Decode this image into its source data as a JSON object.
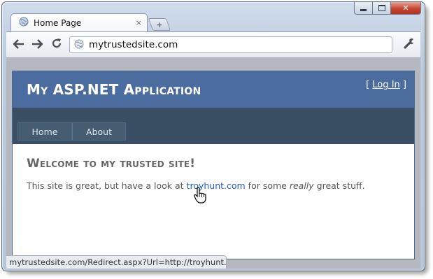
{
  "browser": {
    "tab": {
      "title": "Home Page",
      "close_glyph": "×"
    },
    "new_tab_glyph": "+",
    "omnibox": {
      "url": "mytrustedsite.com"
    },
    "status_bar": {
      "text": "mytrustedsite.com/Redirect.aspx?Url=http://troyhunt.com"
    },
    "icons": {
      "back": "back-arrow-icon",
      "forward": "forward-arrow-icon",
      "reload": "reload-icon",
      "menu": "wrench-icon",
      "favicon": "globe-icon",
      "cursor": "hand-pointer-icon"
    }
  },
  "site": {
    "header": {
      "title": "My ASP.NET Application",
      "login_prefix": "[ ",
      "login_label": "Log In",
      "login_suffix": " ]"
    },
    "menu": {
      "items": [
        {
          "label": "Home"
        },
        {
          "label": "About"
        }
      ]
    },
    "main": {
      "heading": "Welcome to my trusted site!",
      "intro_before": "This site is great, but have a look at ",
      "intro_link": "troyhunt.com",
      "intro_middle": " for some ",
      "intro_emphasis": "really",
      "intro_after": " great stuff."
    }
  },
  "colors": {
    "header_bg": "#4b6c9e",
    "menu_bg": "#3a4f63",
    "link": "#1f5fbf"
  }
}
